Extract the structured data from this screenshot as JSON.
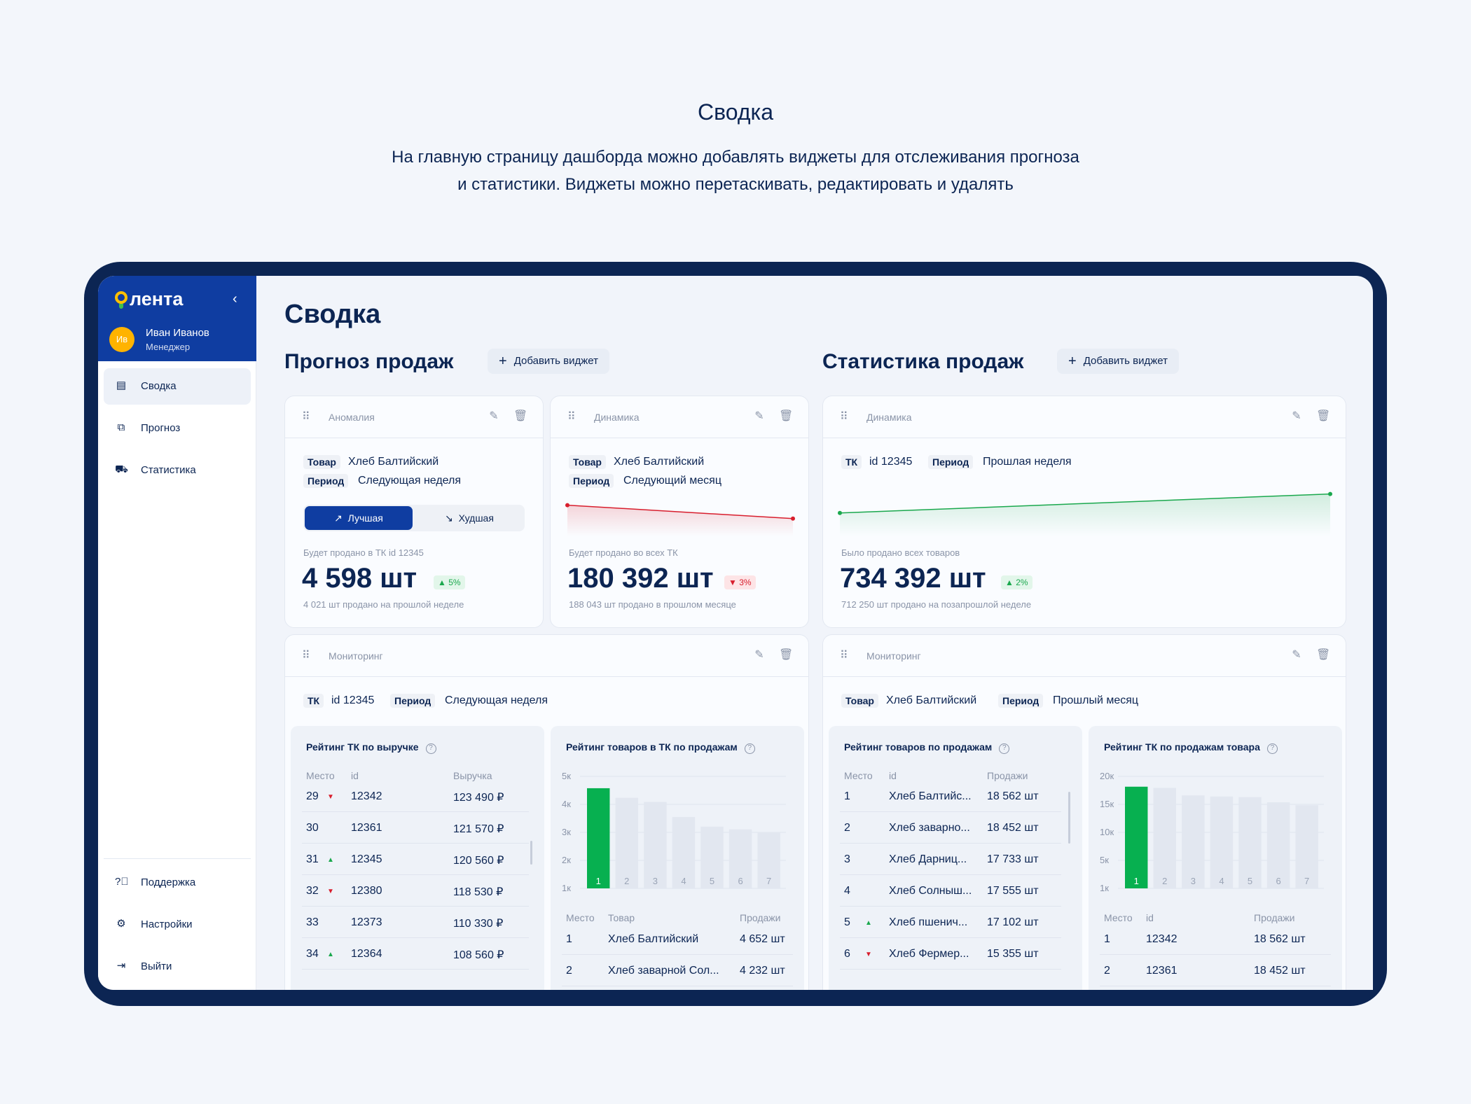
{
  "intro": {
    "title": "Сводка",
    "line1": "На главную страницу дашборда можно добавлять виджеты для отслеживания прогноза",
    "line2": "и статистики. Виджеты можно перетаскивать, редактировать и удалять"
  },
  "sidebar": {
    "logo": "лента",
    "collapse": "‹",
    "user": {
      "initials": "Ив",
      "name": "Иван Иванов",
      "role": "Менеджер"
    },
    "items": [
      {
        "label": "Сводка",
        "icon": "dashboard-icon"
      },
      {
        "label": "Прогноз",
        "icon": "forecast-icon"
      },
      {
        "label": "Статистика",
        "icon": "cart-icon"
      }
    ],
    "bottom": [
      {
        "label": "Поддержка",
        "icon": "help-icon"
      },
      {
        "label": "Настройки",
        "icon": "gear-icon"
      },
      {
        "label": "Выйти",
        "icon": "logout-icon"
      }
    ]
  },
  "page": {
    "title": "Сводка",
    "forecast_title": "Прогноз продаж",
    "stats_title": "Статистика продаж",
    "add_widget": "Добавить виджет"
  },
  "widgets": {
    "anomaly": {
      "label": "Аномалия",
      "product_tag": "Товар",
      "product": "Хлеб Балтийский",
      "period_tag": "Период",
      "period": "Следующая неделя",
      "toggle_best": "Лучшая",
      "toggle_worst": "Худшая",
      "caption": "Будет продано в ТК id 12345",
      "value": "4 598 шт",
      "delta": "5%",
      "footnote": "4 021 шт продано на прошлой неделе"
    },
    "dynamics_forecast": {
      "label": "Динамика",
      "product_tag": "Товар",
      "product": "Хлеб Балтийский",
      "period_tag": "Период",
      "period": "Следующий месяц",
      "caption": "Будет продано во всех ТК",
      "value": "180 392 шт",
      "delta": "3%",
      "footnote": "188 043 шт продано в прошлом месяце"
    },
    "dynamics_stats": {
      "label": "Динамика",
      "tk_tag": "ТК",
      "tk": "id 12345",
      "period_tag": "Период",
      "period": "Прошлая неделя",
      "caption": "Было продано всех товаров",
      "value": "734 392 шт",
      "delta": "2%",
      "footnote": "712 250 шт продано на позапрошлой неделе"
    },
    "monitoring_forecast": {
      "label": "Мониторинг",
      "tk_tag": "ТК",
      "tk": "id 12345",
      "period_tag": "Период",
      "period": "Следующая неделя",
      "revenue_title": "Рейтинг ТК по выручке",
      "revenue_headers": [
        "Место",
        "id",
        "Выручка"
      ],
      "revenue_rows": [
        {
          "place": "29",
          "trend": "down",
          "id": "12342",
          "value": "123 490 ₽"
        },
        {
          "place": "30",
          "trend": "",
          "id": "12361",
          "value": "121 570 ₽"
        },
        {
          "place": "31",
          "trend": "up",
          "id": "12345",
          "value": "120 560 ₽"
        },
        {
          "place": "32",
          "trend": "down",
          "id": "12380",
          "value": "118 530 ₽"
        },
        {
          "place": "33",
          "trend": "",
          "id": "12373",
          "value": "110 330 ₽"
        },
        {
          "place": "34",
          "trend": "up",
          "id": "12364",
          "value": "108 560 ₽"
        }
      ],
      "goods_title": "Рейтинг товаров в ТК по продажам",
      "goods_headers": [
        "Место",
        "Товар",
        "Продажи"
      ],
      "goods_rows": [
        {
          "place": "1",
          "name": "Хлеб Балтийский",
          "value": "4 652 шт"
        },
        {
          "place": "2",
          "name": "Хлеб заварной Сол...",
          "value": "4 232 шт"
        }
      ]
    },
    "monitoring_stats": {
      "label": "Мониторинг",
      "product_tag": "Товар",
      "product": "Хлеб Балтийский",
      "period_tag": "Период",
      "period": "Прошлый месяц",
      "goods_title": "Рейтинг товаров по продажам",
      "goods_headers": [
        "Место",
        "id",
        "Продажи"
      ],
      "goods_rows": [
        {
          "place": "1",
          "trend": "",
          "name": "Хлеб Балтийс...",
          "value": "18 562 шт"
        },
        {
          "place": "2",
          "trend": "",
          "name": "Хлеб заварно...",
          "value": "18 452 шт"
        },
        {
          "place": "3",
          "trend": "",
          "name": "Хлеб Дарниц...",
          "value": "17 733 шт"
        },
        {
          "place": "4",
          "trend": "",
          "name": "Хлеб Солныш...",
          "value": "17 555 шт"
        },
        {
          "place": "5",
          "trend": "up",
          "name": "Хлеб пшенич...",
          "value": "17 102 шт"
        },
        {
          "place": "6",
          "trend": "down",
          "name": "Хлеб Фермер...",
          "value": "15 355 шт"
        }
      ],
      "tk_title": "Рейтинг ТК по продажам товара",
      "tk_headers": [
        "Место",
        "id",
        "Продажи"
      ],
      "tk_rows": [
        {
          "place": "1",
          "id": "12342",
          "value": "18 562 шт"
        },
        {
          "place": "2",
          "id": "12361",
          "value": "18 452 шт"
        }
      ]
    }
  },
  "chart_data": [
    {
      "type": "line",
      "title": "",
      "x": [
        0,
        1
      ],
      "values": [
        2,
        1
      ],
      "color": "#d81e2d"
    },
    {
      "type": "line",
      "title": "",
      "x": [
        0,
        1
      ],
      "values": [
        1,
        2
      ],
      "color": "#1aa84d"
    },
    {
      "type": "bar",
      "title": "Рейтинг товаров в ТК по продажам",
      "categories": [
        "1",
        "2",
        "3",
        "4",
        "5",
        "6",
        "7"
      ],
      "y_ticks": [
        "1к",
        "2к",
        "3к",
        "4к",
        "5к"
      ],
      "ylim": [
        1000,
        5000
      ],
      "values": [
        4650,
        4300,
        4150,
        3600,
        3250,
        3150,
        3050
      ],
      "highlight_color": "#07b050",
      "bar_color": "#e2e7f0"
    },
    {
      "type": "bar",
      "title": "Рейтинг ТК по продажам товара",
      "categories": [
        "1",
        "2",
        "3",
        "4",
        "5",
        "6",
        "7"
      ],
      "y_ticks": [
        "1к",
        "5к",
        "10к",
        "15к",
        "20к"
      ],
      "ylim": [
        1000,
        20000
      ],
      "values": [
        18600,
        18400,
        17100,
        16900,
        16800,
        15900,
        15400
      ],
      "highlight_color": "#07b050",
      "bar_color": "#e2e7f0"
    }
  ]
}
